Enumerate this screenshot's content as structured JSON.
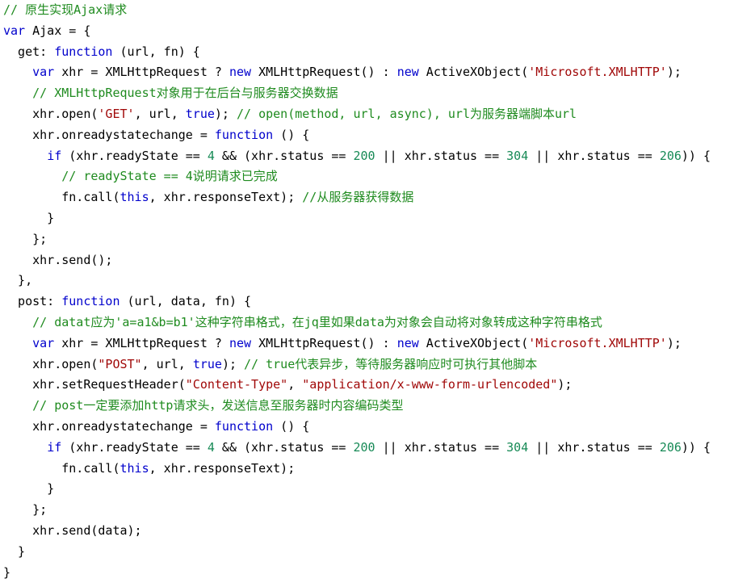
{
  "editor": {
    "language": "javascript",
    "background": "#ffffff",
    "font_size_px": 15,
    "line_height_px": 25.8,
    "colors": {
      "text": "#000000",
      "keyword": "#0000cc",
      "comment": "#1f8b1f",
      "string": "#a00808",
      "number": "#178a56"
    }
  },
  "code": {
    "lines": [
      [
        {
          "t": "// 原生实现Ajax请求",
          "c": "cm"
        }
      ],
      [
        {
          "t": "var",
          "c": "kw"
        },
        {
          "t": " Ajax = {",
          "c": "pl"
        }
      ],
      [
        {
          "t": "  get: ",
          "c": "pl"
        },
        {
          "t": "function",
          "c": "kw"
        },
        {
          "t": " (url, fn) {",
          "c": "pl"
        }
      ],
      [
        {
          "t": "    ",
          "c": "pl"
        },
        {
          "t": "var",
          "c": "kw"
        },
        {
          "t": " xhr = XMLHttpRequest ? ",
          "c": "pl"
        },
        {
          "t": "new",
          "c": "kw"
        },
        {
          "t": " XMLHttpRequest() : ",
          "c": "pl"
        },
        {
          "t": "new",
          "c": "kw"
        },
        {
          "t": " ActiveXObject(",
          "c": "pl"
        },
        {
          "t": "'Microsoft.XMLHTTP'",
          "c": "st"
        },
        {
          "t": ");",
          "c": "pl"
        }
      ],
      [
        {
          "t": "    ",
          "c": "pl"
        },
        {
          "t": "// XMLHttpRequest对象用于在后台与服务器交换数据",
          "c": "cm"
        }
      ],
      [
        {
          "t": "    xhr.open(",
          "c": "pl"
        },
        {
          "t": "'GET'",
          "c": "st"
        },
        {
          "t": ", url, ",
          "c": "pl"
        },
        {
          "t": "true",
          "c": "kw"
        },
        {
          "t": "); ",
          "c": "pl"
        },
        {
          "t": "// open(method, url, async), url为服务器端脚本url",
          "c": "cm"
        }
      ],
      [
        {
          "t": "    xhr.onreadystatechange = ",
          "c": "pl"
        },
        {
          "t": "function",
          "c": "kw"
        },
        {
          "t": " () {",
          "c": "pl"
        }
      ],
      [
        {
          "t": "      ",
          "c": "pl"
        },
        {
          "t": "if",
          "c": "kw"
        },
        {
          "t": " (xhr.readyState == ",
          "c": "pl"
        },
        {
          "t": "4",
          "c": "num"
        },
        {
          "t": " && (xhr.status == ",
          "c": "pl"
        },
        {
          "t": "200",
          "c": "num"
        },
        {
          "t": " || xhr.status == ",
          "c": "pl"
        },
        {
          "t": "304",
          "c": "num"
        },
        {
          "t": " || xhr.status == ",
          "c": "pl"
        },
        {
          "t": "206",
          "c": "num"
        },
        {
          "t": ")) {",
          "c": "pl"
        }
      ],
      [
        {
          "t": "        ",
          "c": "pl"
        },
        {
          "t": "// readyState == 4说明请求已完成",
          "c": "cm"
        }
      ],
      [
        {
          "t": "        fn.call(",
          "c": "pl"
        },
        {
          "t": "this",
          "c": "kw"
        },
        {
          "t": ", xhr.responseText); ",
          "c": "pl"
        },
        {
          "t": "//从服务器获得数据",
          "c": "cm"
        }
      ],
      [
        {
          "t": "      }",
          "c": "pl"
        }
      ],
      [
        {
          "t": "    };",
          "c": "pl"
        }
      ],
      [
        {
          "t": "    xhr.send();",
          "c": "pl"
        }
      ],
      [
        {
          "t": "  },",
          "c": "pl"
        }
      ],
      [
        {
          "t": "  post: ",
          "c": "pl"
        },
        {
          "t": "function",
          "c": "kw"
        },
        {
          "t": " (url, data, fn) {",
          "c": "pl"
        }
      ],
      [
        {
          "t": "    ",
          "c": "pl"
        },
        {
          "t": "// datat应为'a=a1&b=b1'这种字符串格式，在jq里如果data为对象会自动将对象转成这种字符串格式",
          "c": "cm"
        }
      ],
      [
        {
          "t": "    ",
          "c": "pl"
        },
        {
          "t": "var",
          "c": "kw"
        },
        {
          "t": " xhr = XMLHttpRequest ? ",
          "c": "pl"
        },
        {
          "t": "new",
          "c": "kw"
        },
        {
          "t": " XMLHttpRequest() : ",
          "c": "pl"
        },
        {
          "t": "new",
          "c": "kw"
        },
        {
          "t": " ActiveXObject(",
          "c": "pl"
        },
        {
          "t": "'Microsoft.XMLHTTP'",
          "c": "st"
        },
        {
          "t": ");",
          "c": "pl"
        }
      ],
      [
        {
          "t": "    xhr.open(",
          "c": "pl"
        },
        {
          "t": "\"POST\"",
          "c": "st"
        },
        {
          "t": ", url, ",
          "c": "pl"
        },
        {
          "t": "true",
          "c": "kw"
        },
        {
          "t": "); ",
          "c": "pl"
        },
        {
          "t": "// true代表异步，等待服务器响应时可执行其他脚本",
          "c": "cm"
        }
      ],
      [
        {
          "t": "    xhr.setRequestHeader(",
          "c": "pl"
        },
        {
          "t": "\"Content-Type\"",
          "c": "st"
        },
        {
          "t": ", ",
          "c": "pl"
        },
        {
          "t": "\"application/x-www-form-urlencoded\"",
          "c": "st"
        },
        {
          "t": ");",
          "c": "pl"
        }
      ],
      [
        {
          "t": "    ",
          "c": "pl"
        },
        {
          "t": "// post一定要添加http请求头，发送信息至服务器时内容编码类型",
          "c": "cm"
        }
      ],
      [
        {
          "t": "    xhr.onreadystatechange = ",
          "c": "pl"
        },
        {
          "t": "function",
          "c": "kw"
        },
        {
          "t": " () {",
          "c": "pl"
        }
      ],
      [
        {
          "t": "      ",
          "c": "pl"
        },
        {
          "t": "if",
          "c": "kw"
        },
        {
          "t": " (xhr.readyState == ",
          "c": "pl"
        },
        {
          "t": "4",
          "c": "num"
        },
        {
          "t": " && (xhr.status == ",
          "c": "pl"
        },
        {
          "t": "200",
          "c": "num"
        },
        {
          "t": " || xhr.status == ",
          "c": "pl"
        },
        {
          "t": "304",
          "c": "num"
        },
        {
          "t": " || xhr.status == ",
          "c": "pl"
        },
        {
          "t": "206",
          "c": "num"
        },
        {
          "t": ")) {",
          "c": "pl"
        }
      ],
      [
        {
          "t": "        fn.call(",
          "c": "pl"
        },
        {
          "t": "this",
          "c": "kw"
        },
        {
          "t": ", xhr.responseText);",
          "c": "pl"
        }
      ],
      [
        {
          "t": "      }",
          "c": "pl"
        }
      ],
      [
        {
          "t": "    };",
          "c": "pl"
        }
      ],
      [
        {
          "t": "    xhr.send(data);",
          "c": "pl"
        }
      ],
      [
        {
          "t": "  }",
          "c": "pl"
        }
      ],
      [
        {
          "t": "}",
          "c": "pl"
        }
      ]
    ]
  }
}
